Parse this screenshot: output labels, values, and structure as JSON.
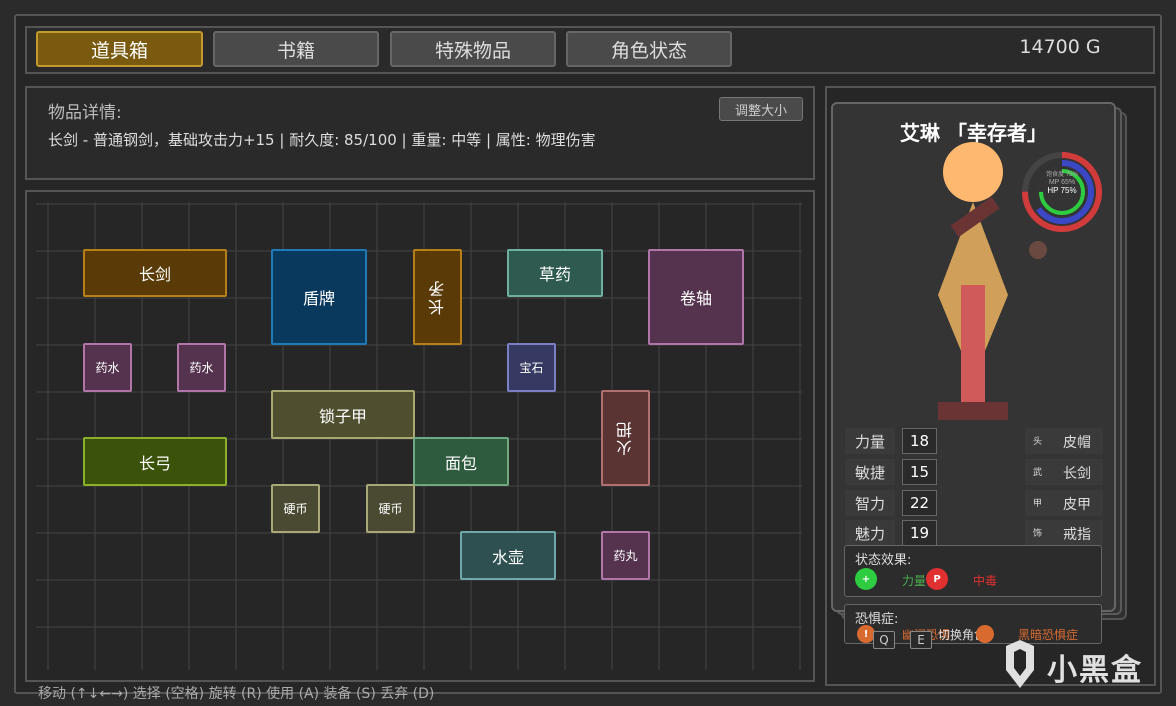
{
  "tabs": [
    {
      "label": "道具箱",
      "active": true
    },
    {
      "label": "书籍",
      "active": false
    },
    {
      "label": "特殊物品",
      "active": false
    },
    {
      "label": "角色状态",
      "active": false
    }
  ],
  "gold": "14700 G",
  "details": {
    "title": "物品详情:",
    "text": "长剑 - 普通钢剑，基础攻击力+15 | 耐久度: 85/100 | 重量: 中等 | 属性: 物理伤害",
    "resize_label": "调整大小"
  },
  "inventory": [
    {
      "name": "长剑",
      "color": "#5a3a06",
      "border": "#b77f1a"
    },
    {
      "name": "盾牌",
      "color": "#093a5e",
      "border": "#1f7ab8"
    },
    {
      "name": "长矛",
      "color": "#5a3a06",
      "border": "#b77f1a"
    },
    {
      "name": "草药",
      "color": "#2e5a50",
      "border": "#6fb0a0"
    },
    {
      "name": "卷轴",
      "color": "#55334f",
      "border": "#b076a8"
    },
    {
      "name": "药水",
      "color": "#55334f",
      "border": "#b076a8"
    },
    {
      "name": "药水",
      "color": "#55334f",
      "border": "#b076a8"
    },
    {
      "name": "宝石",
      "color": "#363a62",
      "border": "#7b80c4"
    },
    {
      "name": "锁子甲",
      "color": "#4f4f2f",
      "border": "#a8a870"
    },
    {
      "name": "长弓",
      "color": "#3a520a",
      "border": "#8cb02a"
    },
    {
      "name": "面包",
      "color": "#2e5a3e",
      "border": "#70a880"
    },
    {
      "name": "火把",
      "color": "#5a3333",
      "border": "#b07070"
    },
    {
      "name": "硬币",
      "color": "#4a4a32",
      "border": "#a8a878"
    },
    {
      "name": "硬币",
      "color": "#4a4a32",
      "border": "#a8a878"
    },
    {
      "name": "水壶",
      "color": "#2e5050",
      "border": "#6fa8a8"
    },
    {
      "name": "药丸",
      "color": "#55334f",
      "border": "#b076a8"
    }
  ],
  "hint": "移动 (↑↓←→) 选择 (空格) 旋转 (R) 使用 (A) 装备 (S) 丢弃 (D)",
  "character": {
    "name": "艾琳 「幸存者」",
    "ring_labels": {
      "outer": "饱食度 75%",
      "middle": "MP 65%",
      "inner": "HP 75%"
    },
    "ring_values": {
      "satiety": 0.75,
      "mp": 0.65,
      "hp": 0.75
    },
    "stats": [
      {
        "label": "力量",
        "value": "18"
      },
      {
        "label": "敏捷",
        "value": "15"
      },
      {
        "label": "智力",
        "value": "22"
      },
      {
        "label": "魅力",
        "value": "19"
      }
    ],
    "equipment": [
      {
        "slot": "头",
        "name": "皮帽"
      },
      {
        "slot": "武",
        "name": "长剑"
      },
      {
        "slot": "甲",
        "name": "皮甲"
      },
      {
        "slot": "饰",
        "name": "戒指"
      }
    ],
    "status": {
      "title": "状态效果:",
      "effects": [
        {
          "icon": "+",
          "text": "力量",
          "color": "#2ecc40",
          "text_color": "#4caf50"
        },
        {
          "icon": "P",
          "text": "中毒",
          "color": "#e03030",
          "text_color": "#e03030"
        }
      ]
    },
    "fear": {
      "title": "恐惧症:",
      "items": [
        {
          "icon": "!",
          "text": "幽闭恐惧",
          "color": "#d86a30"
        },
        {
          "text": "切换角色",
          "color": "#ddd"
        },
        {
          "text": "黑暗恐惧症",
          "color": "#d86a30"
        }
      ],
      "keys": [
        "Q",
        "E"
      ]
    }
  },
  "watermark": "小黑盒"
}
